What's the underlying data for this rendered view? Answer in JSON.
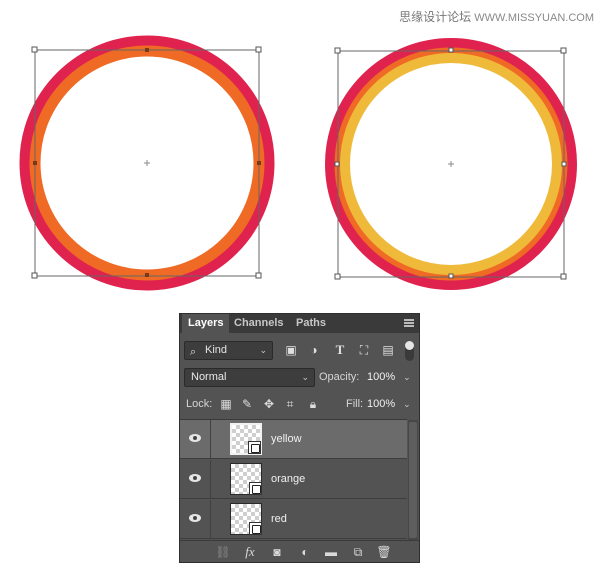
{
  "watermark": {
    "cn_text": "思缘设计论坛",
    "url_text": "WWW.MISSYUAN.COM"
  },
  "canvas": {
    "colors": {
      "red": "#e0234e",
      "orange": "#ef6a24",
      "yellow": "#efb93a",
      "bbox": "#666666"
    },
    "left_artwork": {
      "layers_visible": [
        "red",
        "orange"
      ]
    },
    "right_artwork": {
      "layers_visible": [
        "red",
        "orange",
        "yellow"
      ]
    }
  },
  "panel": {
    "tabs": [
      {
        "label": "Layers",
        "active": true
      },
      {
        "label": "Channels",
        "active": false
      },
      {
        "label": "Paths",
        "active": false
      }
    ],
    "filter": {
      "kind_label": "Kind",
      "icons": [
        "image-filter-icon",
        "adjustment-filter-icon",
        "type-filter-icon",
        "shape-filter-icon",
        "smart-object-filter-icon"
      ]
    },
    "blend": {
      "mode": "Normal",
      "opacity_label": "Opacity:",
      "opacity_value": "100%"
    },
    "lock": {
      "label": "Lock:",
      "fill_label": "Fill:",
      "fill_value": "100%"
    },
    "layers": [
      {
        "name": "yellow",
        "selected": true,
        "visible": true
      },
      {
        "name": "orange",
        "selected": false,
        "visible": true
      },
      {
        "name": "red",
        "selected": false,
        "visible": true
      }
    ],
    "bottom_icons": [
      "link-icon",
      "fx-icon",
      "mask-icon",
      "adjustment-icon",
      "folder-icon",
      "new-layer-icon",
      "trash-icon"
    ]
  }
}
